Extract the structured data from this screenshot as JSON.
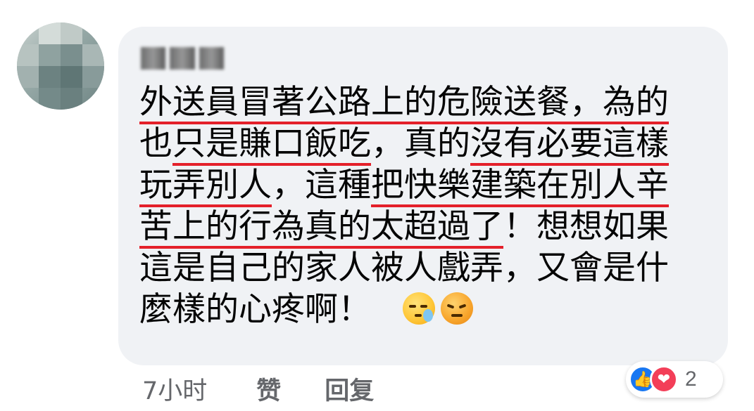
{
  "comment": {
    "author": "",
    "lines": [
      [
        "",
        "外送員冒著公路上的危險送餐，為的",
        ""
      ],
      [
        "也",
        "只是賺口飯吃",
        "，真的"
      ],
      [
        "玩弄別人",
        "，這種",
        "把快樂建築在別人辛"
      ],
      [
        "苦上的行為真的太超過了",
        "！想想如果",
        ""
      ],
      [
        "這是自己的家人被人戲弄，又會是什",
        "",
        ""
      ],
      [
        "麼樣的心疼啊！",
        "",
        ""
      ]
    ],
    "line2_tail": "沒有必要這樣"
  },
  "actions": {
    "time": "7小时",
    "like": "赞",
    "reply": "回复"
  },
  "reactions": {
    "count": "2",
    "icons": [
      "like-icon",
      "love-icon"
    ]
  },
  "emojis": [
    "sleepy-face-emoji",
    "angry-face-emoji"
  ],
  "colors": {
    "underline": "#e4202a",
    "bubble": "#f0f2f5",
    "like": "#1877f2",
    "love": "#f33e58",
    "meta": "#65676b"
  }
}
